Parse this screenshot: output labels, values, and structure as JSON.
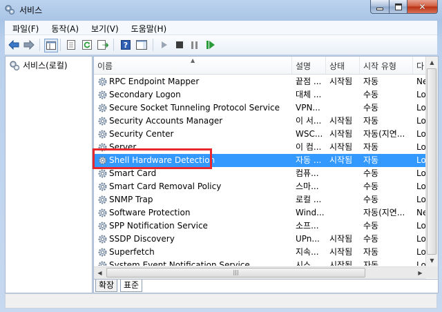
{
  "window": {
    "title": "서비스"
  },
  "menu": [
    "파일(F)",
    "동작(A)",
    "보기(V)",
    "도움말(H)"
  ],
  "tree": {
    "root": "서비스(로컬)"
  },
  "columns": [
    "이름",
    "설명",
    "상태",
    "시작 유형",
    "다"
  ],
  "rows": [
    {
      "name": "RPC Endpoint Mapper",
      "desc": "끝점 ...",
      "status": "시작됨",
      "startup": "자동",
      "logon": "Ne"
    },
    {
      "name": "Secondary Logon",
      "desc": "대체 ...",
      "status": "",
      "startup": "수동",
      "logon": "Lo"
    },
    {
      "name": "Secure Socket Tunneling Protocol Service",
      "desc": "VPN...",
      "status": "",
      "startup": "수동",
      "logon": "Lo"
    },
    {
      "name": "Security Accounts Manager",
      "desc": "이 서...",
      "status": "시작됨",
      "startup": "자동",
      "logon": "Lo"
    },
    {
      "name": "Security Center",
      "desc": "WSC...",
      "status": "시작됨",
      "startup": "자동(지연...",
      "logon": "Lo"
    },
    {
      "name": "Server",
      "desc": "이 컴...",
      "status": "시작됨",
      "startup": "자동",
      "logon": "Lo"
    },
    {
      "name": "Shell Hardware Detection",
      "desc": "자동 ...",
      "status": "시작됨",
      "startup": "자동",
      "logon": "Lo",
      "selected": true
    },
    {
      "name": "Smart Card",
      "desc": "컴퓨...",
      "status": "",
      "startup": "수동",
      "logon": "Lo"
    },
    {
      "name": "Smart Card Removal Policy",
      "desc": "스마...",
      "status": "",
      "startup": "수동",
      "logon": "Lo"
    },
    {
      "name": "SNMP Trap",
      "desc": "로컬 ...",
      "status": "",
      "startup": "수동",
      "logon": "Lo"
    },
    {
      "name": "Software Protection",
      "desc": "Wind...",
      "status": "",
      "startup": "자동(지연...",
      "logon": "Ne"
    },
    {
      "name": "SPP Notification Service",
      "desc": "소프...",
      "status": "",
      "startup": "수동",
      "logon": "Lo"
    },
    {
      "name": "SSDP Discovery",
      "desc": "UPn...",
      "status": "시작됨",
      "startup": "수동",
      "logon": "Lo"
    },
    {
      "name": "Superfetch",
      "desc": "지속...",
      "status": "시작됨",
      "startup": "자동",
      "logon": "Lo"
    },
    {
      "name": "System Event Notification Service",
      "desc": "시스...",
      "status": "시작됨",
      "startup": "자동",
      "logon": "Lo"
    }
  ],
  "tabs": [
    "확장",
    "표준"
  ],
  "colors": {
    "selection": "#3399ff",
    "highlight_box": "#e8262d"
  }
}
